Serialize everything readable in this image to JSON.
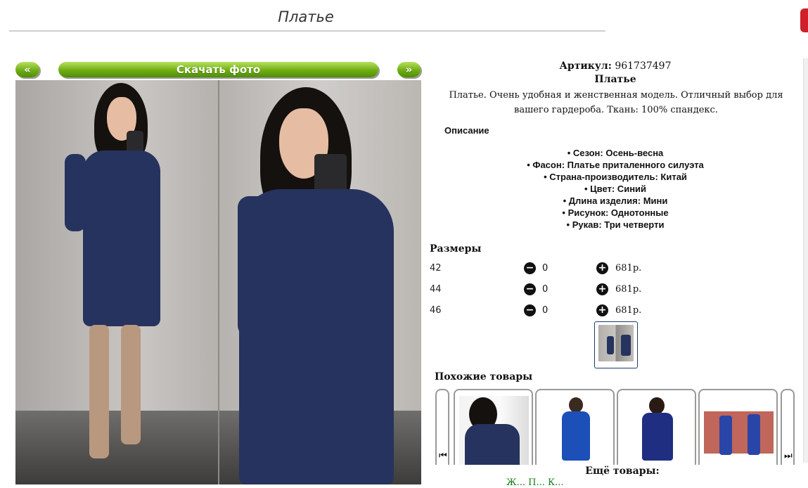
{
  "page": {
    "title": "Платье"
  },
  "buttons": {
    "prev": "«",
    "download": "Скачать фото",
    "next": "»"
  },
  "product": {
    "article_label": "Артикул:",
    "article": "961737497",
    "name": "Платье",
    "description": "Платье. Очень удобная и женственная модель. Отличный выбор для вашего гардероба. Ткань: 100% спандекс.",
    "description_heading": "Описание",
    "properties": [
      "Сезон: Осень-весна",
      "Фасон: Платье приталенного силуэта",
      "Страна-производитель: Китай",
      "Цвет: Синий",
      "Длина изделия: Мини",
      "Рисунок: Однотонные",
      "Рукав: Три четверти"
    ]
  },
  "sizes": {
    "heading": "Размеры",
    "rows": [
      {
        "size": "42",
        "qty": "0",
        "price": "681р."
      },
      {
        "size": "44",
        "qty": "0",
        "price": "681р."
      },
      {
        "size": "46",
        "qty": "0",
        "price": "681р."
      }
    ]
  },
  "similar": {
    "heading": "Похожие товары"
  },
  "more": {
    "heading": "Ещё товары:",
    "links": "Ж...   П... К..."
  },
  "icons": {
    "minus": "minus-circle-icon",
    "plus": "plus-circle-icon",
    "carousel_prev": "skip-back-icon",
    "carousel_next": "skip-forward-icon"
  },
  "colors": {
    "accent_green": "#6fae12",
    "dress_blue": "#26335e",
    "link_green": "#127a12"
  }
}
